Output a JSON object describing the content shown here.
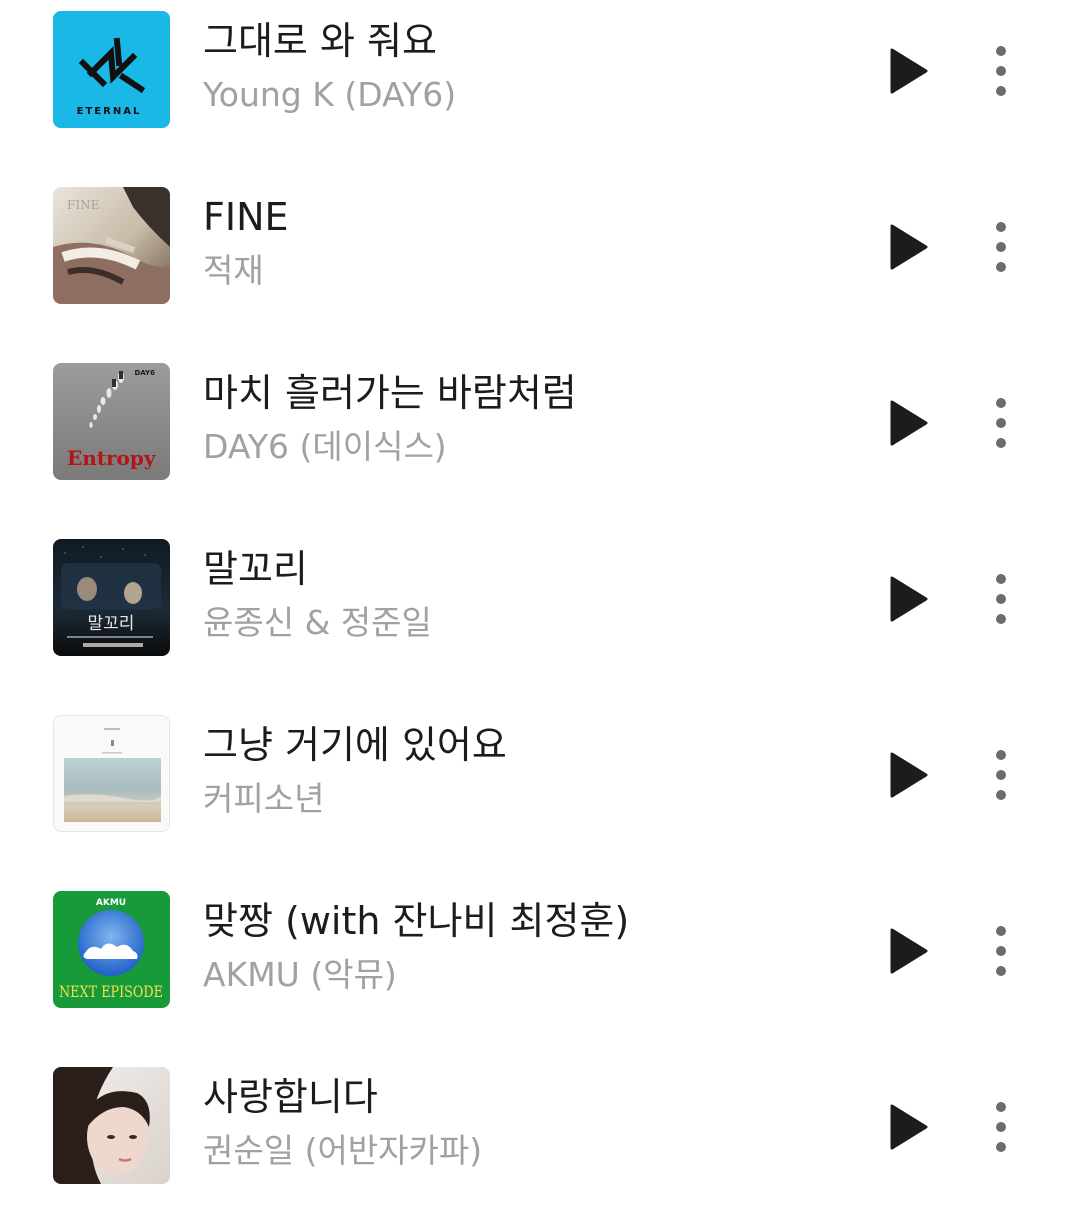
{
  "colors": {
    "title": "#1c1c1e",
    "artist": "#a0a0a5",
    "icon": "#1c1c1e",
    "more_icon": "#6b6b6b"
  },
  "tracks": [
    {
      "title": "그대로 와 줘요",
      "artist": "Young K (DAY6)",
      "cover_text": "ETERNAL",
      "play_icon": "play-icon",
      "more_icon": "more-vertical-icon"
    },
    {
      "title": "FINE",
      "artist": "적재",
      "cover_text": "FINE",
      "play_icon": "play-icon",
      "more_icon": "more-vertical-icon"
    },
    {
      "title": "마치 흘러가는 바람처럼",
      "artist": "DAY6 (데이식스)",
      "cover_text": "Entropy",
      "cover_subtext": "DAY6",
      "play_icon": "play-icon",
      "more_icon": "more-vertical-icon"
    },
    {
      "title": "말꼬리",
      "artist": "윤종신 & 정준일",
      "cover_text": "말꼬리",
      "play_icon": "play-icon",
      "more_icon": "more-vertical-icon"
    },
    {
      "title": "그냥 거기에 있어요",
      "artist": "커피소년",
      "play_icon": "play-icon",
      "more_icon": "more-vertical-icon"
    },
    {
      "title": "맞짱 (with 잔나비 최정훈)",
      "artist": "AKMU (악뮤)",
      "cover_text": "NEXT EPISODE",
      "cover_subtext": "AKMU",
      "play_icon": "play-icon",
      "more_icon": "more-vertical-icon"
    },
    {
      "title": "사랑합니다",
      "artist": "권순일 (어반자카파)",
      "play_icon": "play-icon",
      "more_icon": "more-vertical-icon"
    }
  ]
}
